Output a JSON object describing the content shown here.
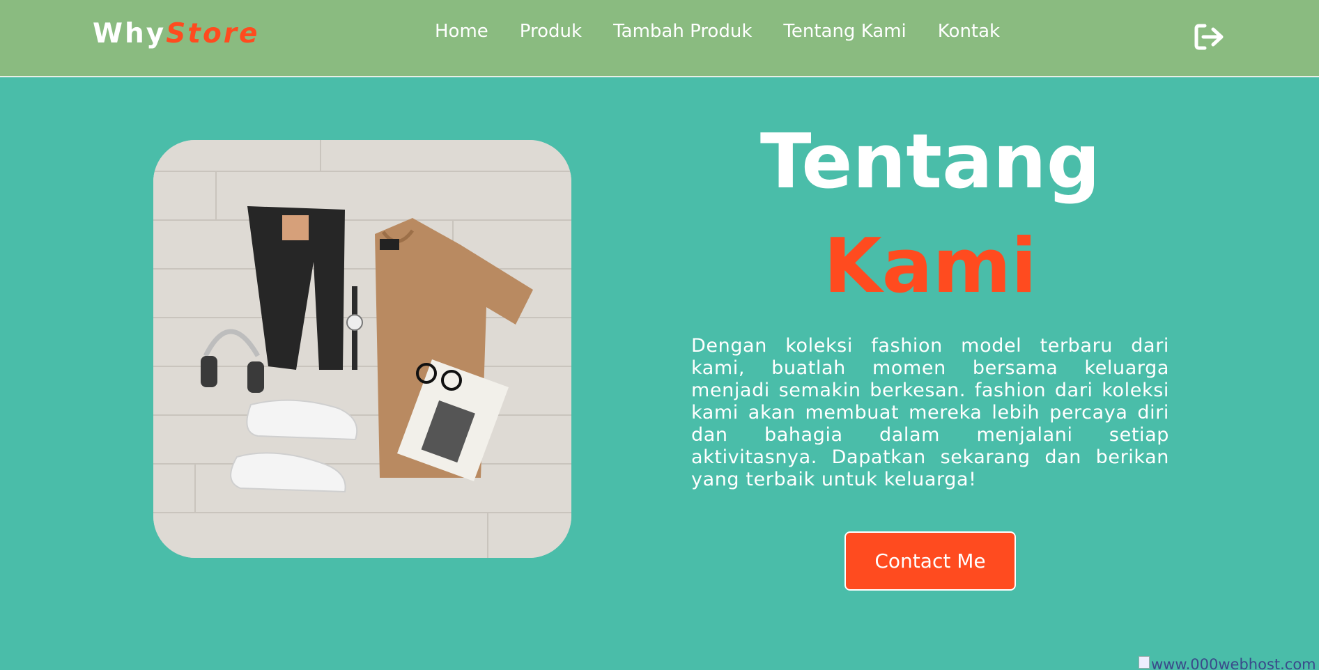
{
  "navbar": {
    "logo_part1": "Why",
    "logo_part2": "Store",
    "links": [
      "Home",
      "Produk",
      "Tambah Produk",
      "Tentang Kami",
      "Kontak"
    ],
    "logout_icon": "sign-out-icon"
  },
  "hero": {
    "image_icon": "product-flatlay-photo",
    "title_line1": "Tentang",
    "title_line2": "Kami",
    "description": "Dengan koleksi fashion model terbaru dari kami, buatlah momen bersama keluarga menjadi semakin berkesan. fashion dari koleksi kami akan membuat mereka lebih percaya diri dan bahagia dalam menjalani setiap aktivitasnya. Dapatkan sekarang dan berikan yang terbaik untuk keluarga!",
    "button_label": "Contact Me"
  },
  "footer": {
    "host_badge": "www.000webhost.com"
  },
  "colors": {
    "navbar_bg": "#8abb80",
    "page_bg": "#4abda9",
    "accent": "#ff4b1f",
    "text": "#ffffff"
  }
}
